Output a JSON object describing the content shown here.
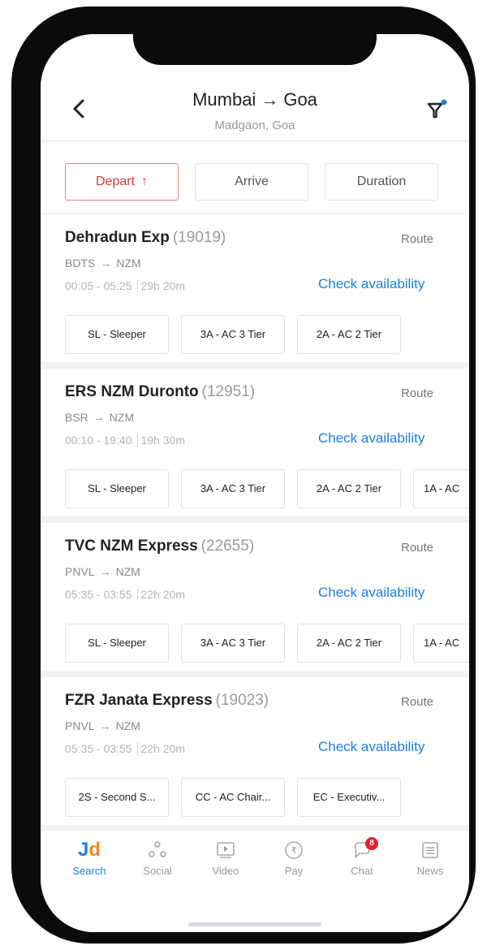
{
  "header": {
    "origin": "Mumbai",
    "arrow": "→",
    "destination": "Goa",
    "subtitle": "Madgaon, Goa"
  },
  "sort": {
    "depart": "Depart",
    "depart_arrow": "↑",
    "arrive": "Arrive",
    "duration": "Duration"
  },
  "trains": [
    {
      "name": "Dehradun Exp",
      "number": "(19019)",
      "route_label": "Route",
      "from": "BDTS",
      "arrow": "→",
      "to": "NZM",
      "time": "00:05 - 05:25",
      "duration": "29h 20m",
      "check_label": "Check availability",
      "classes": [
        "SL - Sleeper",
        "3A - AC 3 Tier",
        "2A - AC 2 Tier"
      ]
    },
    {
      "name": "ERS NZM Duronto",
      "number": "(12951)",
      "route_label": "Route",
      "from": "BSR",
      "arrow": "→",
      "to": "NZM",
      "time": "00:10 - 19:40",
      "duration": "19h 30m",
      "check_label": "Check availability",
      "classes": [
        "SL - Sleeper",
        "3A - AC 3 Tier",
        "2A - AC 2 Tier",
        "1A - AC"
      ]
    },
    {
      "name": "TVC NZM Express",
      "number": "(22655)",
      "route_label": "Route",
      "from": "PNVL",
      "arrow": "→",
      "to": "NZM",
      "time": "05:35 - 03:55",
      "duration": "22h 20m",
      "check_label": "Check availability",
      "classes": [
        "SL - Sleeper",
        "3A - AC 3 Tier",
        "2A - AC 2 Tier",
        "1A - AC"
      ]
    },
    {
      "name": "FZR Janata Express",
      "number": "(19023)",
      "route_label": "Route",
      "from": "PNVL",
      "arrow": "→",
      "to": "NZM",
      "time": "05:35 - 03:55",
      "duration": "22h 20m",
      "check_label": "Check availability",
      "classes": [
        "2S - Second S...",
        "CC - AC Chair...",
        "EC - Executiv..."
      ]
    }
  ],
  "nav": {
    "search": "Search",
    "social": "Social",
    "video": "Video",
    "pay": "Pay",
    "chat": "Chat",
    "chat_badge": "8",
    "news": "News",
    "logo_j": "J",
    "logo_d": "d"
  },
  "colors": {
    "accent_blue": "#1a7fe0",
    "active_red": "#d8383f",
    "badge_red": "#e0242c"
  },
  "icons": [
    "back-chevron-icon",
    "filter-icon",
    "social-icon",
    "video-icon",
    "rupee-icon",
    "chat-icon",
    "news-icon"
  ]
}
